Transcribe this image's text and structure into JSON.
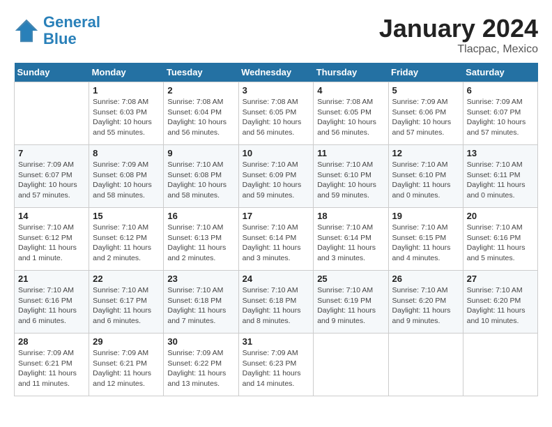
{
  "header": {
    "logo_line1": "General",
    "logo_line2": "Blue",
    "title": "January 2024",
    "subtitle": "Tlacpac, Mexico"
  },
  "weekdays": [
    "Sunday",
    "Monday",
    "Tuesday",
    "Wednesday",
    "Thursday",
    "Friday",
    "Saturday"
  ],
  "weeks": [
    [
      {
        "day": "",
        "sunrise": "",
        "sunset": "",
        "daylight": ""
      },
      {
        "day": "1",
        "sunrise": "Sunrise: 7:08 AM",
        "sunset": "Sunset: 6:03 PM",
        "daylight": "Daylight: 10 hours and 55 minutes."
      },
      {
        "day": "2",
        "sunrise": "Sunrise: 7:08 AM",
        "sunset": "Sunset: 6:04 PM",
        "daylight": "Daylight: 10 hours and 56 minutes."
      },
      {
        "day": "3",
        "sunrise": "Sunrise: 7:08 AM",
        "sunset": "Sunset: 6:05 PM",
        "daylight": "Daylight: 10 hours and 56 minutes."
      },
      {
        "day": "4",
        "sunrise": "Sunrise: 7:08 AM",
        "sunset": "Sunset: 6:05 PM",
        "daylight": "Daylight: 10 hours and 56 minutes."
      },
      {
        "day": "5",
        "sunrise": "Sunrise: 7:09 AM",
        "sunset": "Sunset: 6:06 PM",
        "daylight": "Daylight: 10 hours and 57 minutes."
      },
      {
        "day": "6",
        "sunrise": "Sunrise: 7:09 AM",
        "sunset": "Sunset: 6:07 PM",
        "daylight": "Daylight: 10 hours and 57 minutes."
      }
    ],
    [
      {
        "day": "7",
        "sunrise": "Sunrise: 7:09 AM",
        "sunset": "Sunset: 6:07 PM",
        "daylight": "Daylight: 10 hours and 57 minutes."
      },
      {
        "day": "8",
        "sunrise": "Sunrise: 7:09 AM",
        "sunset": "Sunset: 6:08 PM",
        "daylight": "Daylight: 10 hours and 58 minutes."
      },
      {
        "day": "9",
        "sunrise": "Sunrise: 7:10 AM",
        "sunset": "Sunset: 6:08 PM",
        "daylight": "Daylight: 10 hours and 58 minutes."
      },
      {
        "day": "10",
        "sunrise": "Sunrise: 7:10 AM",
        "sunset": "Sunset: 6:09 PM",
        "daylight": "Daylight: 10 hours and 59 minutes."
      },
      {
        "day": "11",
        "sunrise": "Sunrise: 7:10 AM",
        "sunset": "Sunset: 6:10 PM",
        "daylight": "Daylight: 10 hours and 59 minutes."
      },
      {
        "day": "12",
        "sunrise": "Sunrise: 7:10 AM",
        "sunset": "Sunset: 6:10 PM",
        "daylight": "Daylight: 11 hours and 0 minutes."
      },
      {
        "day": "13",
        "sunrise": "Sunrise: 7:10 AM",
        "sunset": "Sunset: 6:11 PM",
        "daylight": "Daylight: 11 hours and 0 minutes."
      }
    ],
    [
      {
        "day": "14",
        "sunrise": "Sunrise: 7:10 AM",
        "sunset": "Sunset: 6:12 PM",
        "daylight": "Daylight: 11 hours and 1 minute."
      },
      {
        "day": "15",
        "sunrise": "Sunrise: 7:10 AM",
        "sunset": "Sunset: 6:12 PM",
        "daylight": "Daylight: 11 hours and 2 minutes."
      },
      {
        "day": "16",
        "sunrise": "Sunrise: 7:10 AM",
        "sunset": "Sunset: 6:13 PM",
        "daylight": "Daylight: 11 hours and 2 minutes."
      },
      {
        "day": "17",
        "sunrise": "Sunrise: 7:10 AM",
        "sunset": "Sunset: 6:14 PM",
        "daylight": "Daylight: 11 hours and 3 minutes."
      },
      {
        "day": "18",
        "sunrise": "Sunrise: 7:10 AM",
        "sunset": "Sunset: 6:14 PM",
        "daylight": "Daylight: 11 hours and 3 minutes."
      },
      {
        "day": "19",
        "sunrise": "Sunrise: 7:10 AM",
        "sunset": "Sunset: 6:15 PM",
        "daylight": "Daylight: 11 hours and 4 minutes."
      },
      {
        "day": "20",
        "sunrise": "Sunrise: 7:10 AM",
        "sunset": "Sunset: 6:16 PM",
        "daylight": "Daylight: 11 hours and 5 minutes."
      }
    ],
    [
      {
        "day": "21",
        "sunrise": "Sunrise: 7:10 AM",
        "sunset": "Sunset: 6:16 PM",
        "daylight": "Daylight: 11 hours and 6 minutes."
      },
      {
        "day": "22",
        "sunrise": "Sunrise: 7:10 AM",
        "sunset": "Sunset: 6:17 PM",
        "daylight": "Daylight: 11 hours and 6 minutes."
      },
      {
        "day": "23",
        "sunrise": "Sunrise: 7:10 AM",
        "sunset": "Sunset: 6:18 PM",
        "daylight": "Daylight: 11 hours and 7 minutes."
      },
      {
        "day": "24",
        "sunrise": "Sunrise: 7:10 AM",
        "sunset": "Sunset: 6:18 PM",
        "daylight": "Daylight: 11 hours and 8 minutes."
      },
      {
        "day": "25",
        "sunrise": "Sunrise: 7:10 AM",
        "sunset": "Sunset: 6:19 PM",
        "daylight": "Daylight: 11 hours and 9 minutes."
      },
      {
        "day": "26",
        "sunrise": "Sunrise: 7:10 AM",
        "sunset": "Sunset: 6:20 PM",
        "daylight": "Daylight: 11 hours and 9 minutes."
      },
      {
        "day": "27",
        "sunrise": "Sunrise: 7:10 AM",
        "sunset": "Sunset: 6:20 PM",
        "daylight": "Daylight: 11 hours and 10 minutes."
      }
    ],
    [
      {
        "day": "28",
        "sunrise": "Sunrise: 7:09 AM",
        "sunset": "Sunset: 6:21 PM",
        "daylight": "Daylight: 11 hours and 11 minutes."
      },
      {
        "day": "29",
        "sunrise": "Sunrise: 7:09 AM",
        "sunset": "Sunset: 6:21 PM",
        "daylight": "Daylight: 11 hours and 12 minutes."
      },
      {
        "day": "30",
        "sunrise": "Sunrise: 7:09 AM",
        "sunset": "Sunset: 6:22 PM",
        "daylight": "Daylight: 11 hours and 13 minutes."
      },
      {
        "day": "31",
        "sunrise": "Sunrise: 7:09 AM",
        "sunset": "Sunset: 6:23 PM",
        "daylight": "Daylight: 11 hours and 14 minutes."
      },
      {
        "day": "",
        "sunrise": "",
        "sunset": "",
        "daylight": ""
      },
      {
        "day": "",
        "sunrise": "",
        "sunset": "",
        "daylight": ""
      },
      {
        "day": "",
        "sunrise": "",
        "sunset": "",
        "daylight": ""
      }
    ]
  ]
}
